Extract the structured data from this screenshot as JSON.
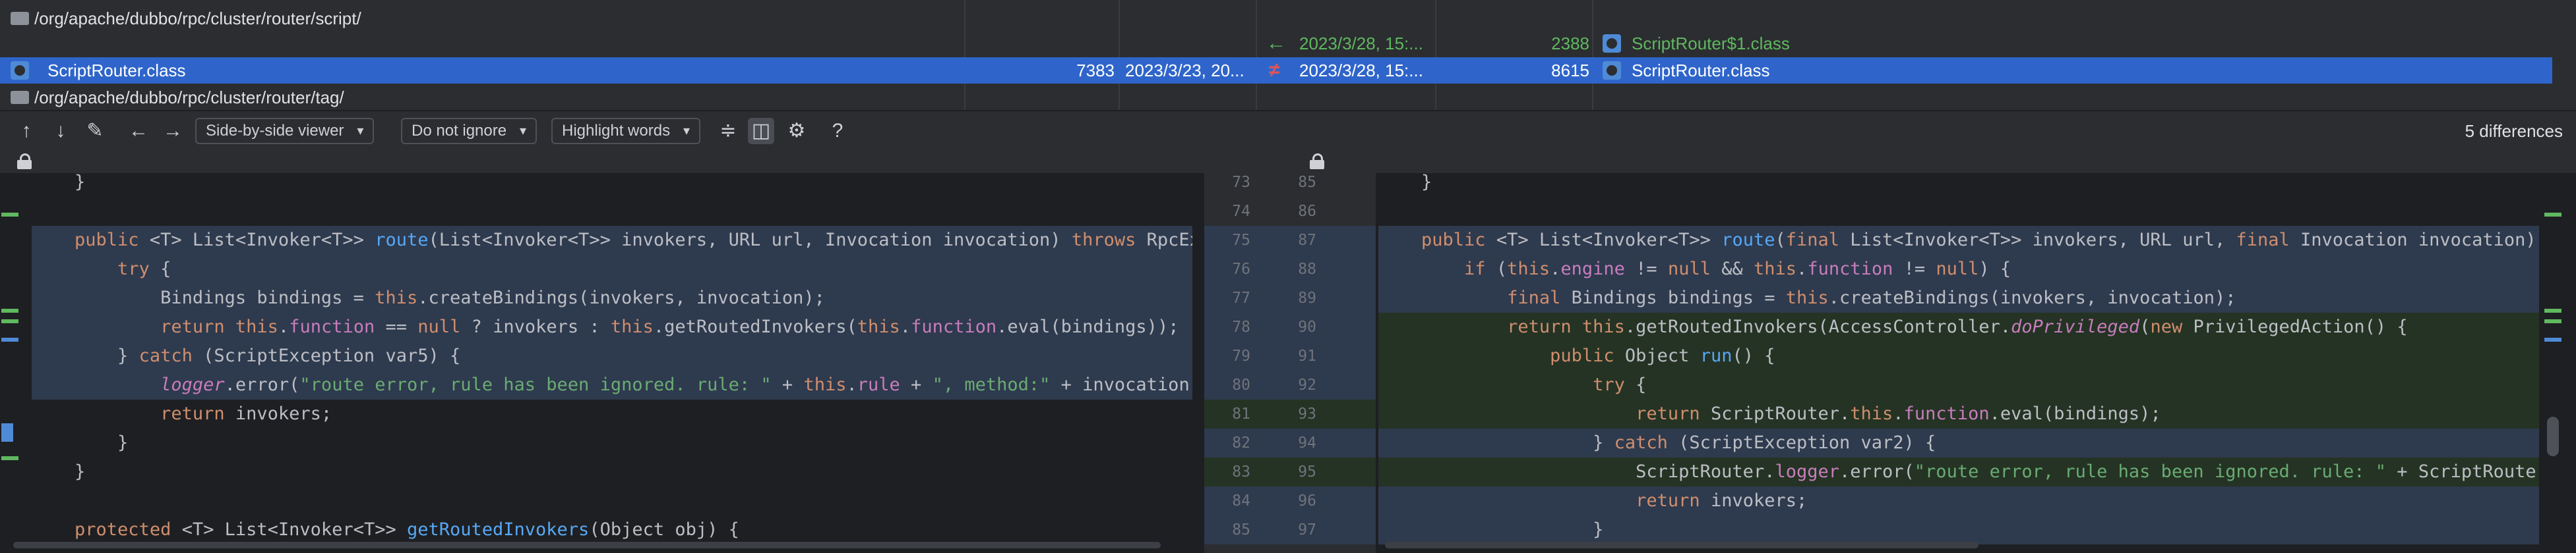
{
  "tree": {
    "folder1": "/org/apache/dubbo/rpc/cluster/router/script/",
    "changed_row": {
      "arrow": "←",
      "right_date": "2023/3/28, 15:...",
      "right_size": "2388",
      "right_name": "ScriptRouter$1.class"
    },
    "selected_row": {
      "left_name": "ScriptRouter.class",
      "left_size": "7383",
      "left_date": "2023/3/23, 20...",
      "status": "≠",
      "right_date": "2023/3/28, 15:...",
      "right_size": "8615",
      "right_name": "ScriptRouter.class"
    },
    "folder2": "/org/apache/dubbo/rpc/cluster/router/tag/"
  },
  "toolbar": {
    "viewer": "Side-by-side viewer",
    "ignore": "Do not ignore",
    "highlight": "Highlight words",
    "help": "?",
    "diff_count": "5 differences"
  },
  "left_code": [
    {
      "n": "73",
      "t": "    }"
    },
    {
      "n": "74",
      "t": ""
    },
    {
      "n": "75",
      "t": "    public <T> List<Invoker<T>> route(List<Invoker<T>> invokers, URL url, Invocation invocation) throws RpcExc"
    },
    {
      "n": "76",
      "t": "        try {"
    },
    {
      "n": "77",
      "t": "            Bindings bindings = this.createBindings(invokers, invocation);"
    },
    {
      "n": "78",
      "t": "            return this.function == null ? invokers : this.getRoutedInvokers(this.function.eval(bindings));"
    },
    {
      "n": "79",
      "t": "        } catch (ScriptException var5) {"
    },
    {
      "n": "80",
      "t": "            logger.error(\"route error, rule has been ignored. rule: \" + this.rule + \", method:\" + invocation.g"
    },
    {
      "n": "81",
      "t": "            return invokers;"
    },
    {
      "n": "82",
      "t": "        }"
    },
    {
      "n": "83",
      "t": "    }"
    },
    {
      "n": "84",
      "t": ""
    },
    {
      "n": "85",
      "t": "    protected <T> List<Invoker<T>> getRoutedInvokers(Object obj) {"
    }
  ],
  "right_code": [
    {
      "n": "85",
      "t": "    }"
    },
    {
      "n": "86",
      "t": ""
    },
    {
      "n": "87",
      "t": "    public <T> List<Invoker<T>> route(final List<Invoker<T>> invokers, URL url, final Invocation invocation) thro"
    },
    {
      "n": "88",
      "t": "        if (this.engine != null && this.function != null) {"
    },
    {
      "n": "89",
      "t": "            final Bindings bindings = this.createBindings(invokers, invocation);"
    },
    {
      "n": "90",
      "t": "            return this.getRoutedInvokers(AccessController.doPrivileged(new PrivilegedAction() {"
    },
    {
      "n": "91",
      "t": "                public Object run() {"
    },
    {
      "n": "92",
      "t": "                    try {"
    },
    {
      "n": "93",
      "t": "                        return ScriptRouter.this.function.eval(bindings);"
    },
    {
      "n": "94",
      "t": "                    } catch (ScriptException var2) {"
    },
    {
      "n": "95",
      "t": "                        ScriptRouter.logger.error(\"route error, rule has been ignored. rule: \" + ScriptRouter.th"
    },
    {
      "n": "96",
      "t": "                        return invokers;"
    },
    {
      "n": "97",
      "t": "                    }"
    }
  ],
  "colors": {
    "selection": "#2f65ca",
    "modified": "#2e3a4e",
    "added": "#243324",
    "keyword": "#cf8e6d",
    "function": "#56a8f5",
    "string": "#6aab73",
    "field": "#c77dbb"
  },
  "icons": [
    "folder-icon",
    "class-file-icon",
    "arrow-up-icon",
    "arrow-down-icon",
    "edit-icon",
    "back-icon",
    "forward-icon",
    "collapse-icon",
    "sync-scroll-icon",
    "settings-icon",
    "lock-icon"
  ]
}
